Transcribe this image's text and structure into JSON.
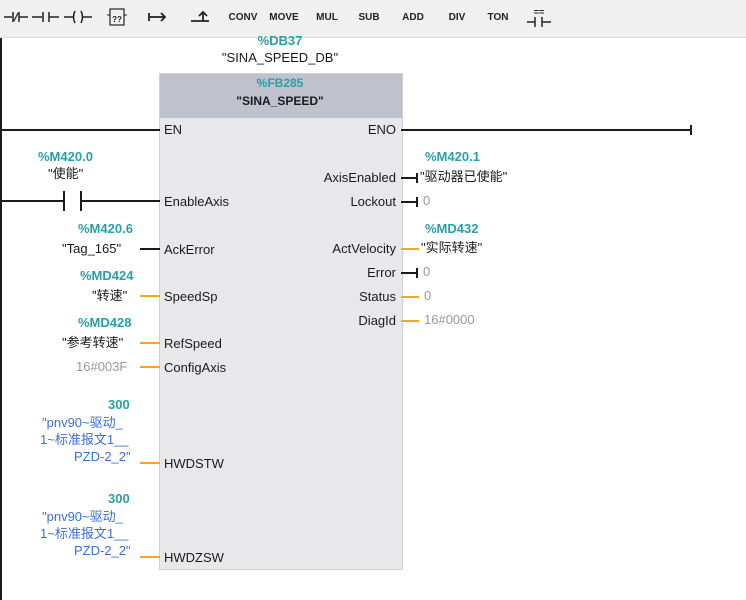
{
  "toolbar": {
    "buttons": [
      {
        "icon": "rung-icon",
        "label": ""
      },
      {
        "icon": "contact-no-icon",
        "label": ""
      },
      {
        "icon": "coil-icon",
        "label": ""
      },
      {
        "icon": "empty-box-icon",
        "label": "??"
      },
      {
        "icon": "branch-open-icon",
        "label": ""
      },
      {
        "icon": "branch-close-icon",
        "label": ""
      },
      {
        "icon": "",
        "label": "CONV"
      },
      {
        "icon": "",
        "label": "MOVE"
      },
      {
        "icon": "",
        "label": "MUL"
      },
      {
        "icon": "",
        "label": "SUB"
      },
      {
        "icon": "",
        "label": "ADD"
      },
      {
        "icon": "",
        "label": "DIV"
      },
      {
        "icon": "",
        "label": "TON"
      },
      {
        "icon": "compare-eq-icon",
        "label": "=="
      }
    ]
  },
  "block": {
    "db_addr": "%DB37",
    "db_name": "\"SINA_SPEED_DB\"",
    "fb_addr": "%FB285",
    "fb_name": "\"SINA_SPEED\""
  },
  "inputs": {
    "en": "EN",
    "enable_axis": {
      "addr": "%M420.0",
      "symbol": "\"使能\"",
      "pin": "EnableAxis"
    },
    "ack_error": {
      "addr": "%M420.6",
      "symbol": "\"Tag_165\"",
      "pin": "AckError"
    },
    "speed_sp": {
      "addr": "%MD424",
      "symbol": "\"转速\"",
      "pin": "SpeedSp"
    },
    "ref_speed": {
      "addr": "%MD428",
      "symbol": "\"参考转速\"",
      "pin": "RefSpeed"
    },
    "config_axis": {
      "value": "16#003F",
      "pin": "ConfigAxis"
    },
    "hwdstw": {
      "value": "300",
      "line1": "\"pnv90~驱动_",
      "line2": "1~标准报文1__",
      "line3": "PZD-2_2\"",
      "pin": "HWDSTW"
    },
    "hwdzsw": {
      "value": "300",
      "line1": "\"pnv90~驱动_",
      "line2": "1~标准报文1__",
      "line3": "PZD-2_2\"",
      "pin": "HWDZSW"
    }
  },
  "outputs": {
    "eno": "ENO",
    "axis_enabled": {
      "addr": "%M420.1",
      "symbol": "\"驱动器已使能\"",
      "pin": "AxisEnabled"
    },
    "lockout": {
      "value": "0",
      "pin": "Lockout"
    },
    "act_velocity": {
      "addr": "%MD432",
      "symbol": "\"实际转速\"",
      "pin": "ActVelocity"
    },
    "error": {
      "value": "0",
      "pin": "Error"
    },
    "status": {
      "value": "0",
      "pin": "Status"
    },
    "diag_id": {
      "value": "16#0000",
      "pin": "DiagId"
    }
  }
}
